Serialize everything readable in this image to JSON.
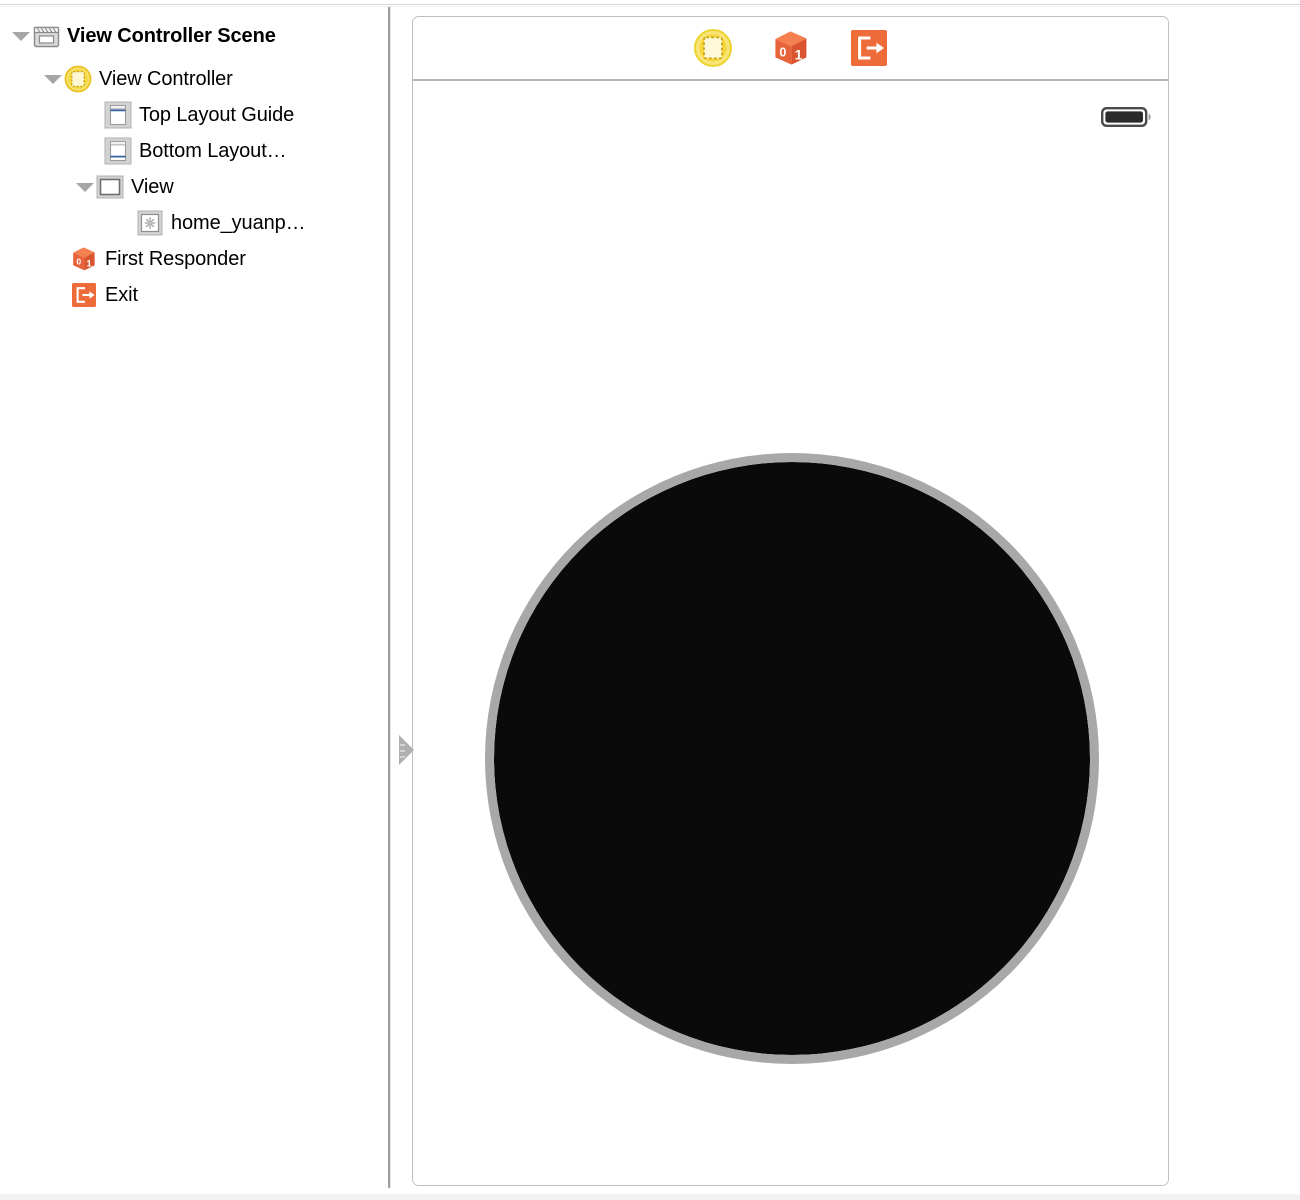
{
  "window": {
    "title": "Interface Builder — Storyboard"
  },
  "sidebar": {
    "name": "document-outline",
    "items": [
      {
        "label": "View Controller Scene",
        "icon": "scene-clapperboard-icon",
        "indent": 0,
        "expanded": true,
        "bold": true
      },
      {
        "label": "View Controller",
        "icon": "view-controller-icon",
        "indent": 1,
        "expanded": true,
        "bold": false
      },
      {
        "label": "Top Layout Guide",
        "icon": "top-layout-guide-icon",
        "indent": 2,
        "expanded": null,
        "bold": false
      },
      {
        "label": "Bottom Layout…",
        "icon": "bottom-layout-guide-icon",
        "indent": 2,
        "expanded": null,
        "bold": false
      },
      {
        "label": "View",
        "icon": "view-icon",
        "indent": 2,
        "expanded": true,
        "bold": false
      },
      {
        "label": "home_yuanp…",
        "icon": "image-view-icon",
        "indent": 3,
        "expanded": null,
        "bold": false
      },
      {
        "label": "First Responder",
        "icon": "first-responder-icon",
        "indent": 1,
        "expanded": null,
        "bold": false
      },
      {
        "label": "Exit",
        "icon": "exit-icon",
        "indent": 1,
        "expanded": null,
        "bold": false
      }
    ]
  },
  "canvas": {
    "scene_name": "View Controller Scene",
    "toolbar": {
      "icons": [
        {
          "name": "view-controller-icon",
          "title": "View Controller"
        },
        {
          "name": "first-responder-icon",
          "title": "First Responder"
        },
        {
          "name": "exit-icon",
          "title": "Exit"
        }
      ]
    },
    "status_bar": {
      "battery_icon": "battery-full-icon"
    },
    "entry_point": {
      "name": "storyboard-entry-point-arrow"
    },
    "subviews": [
      {
        "name": "home_yuanpan-image-view",
        "shape": "circle",
        "fill_color": "#0a0a0a",
        "border_color": "#a8a8a8"
      }
    ]
  },
  "colors": {
    "accent_orange": "#ef6b35",
    "accent_yellow": "#f5cf2b",
    "outline_gray": "#bfbfbf",
    "circle_black": "#0a0a0a",
    "circle_ring": "#a8a8a8"
  }
}
